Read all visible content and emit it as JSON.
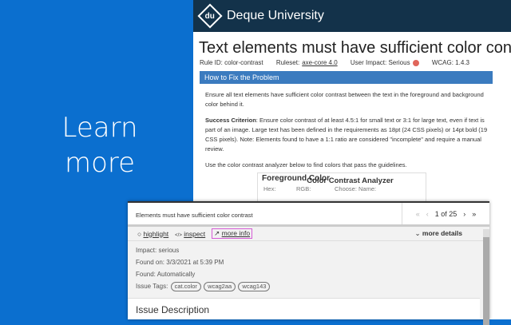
{
  "promo": {
    "text": "Learn more"
  },
  "site": {
    "logo": "du",
    "name": "Deque University"
  },
  "rule": {
    "title": "Text elements must have sufficient color contrast against",
    "rule_id": "Rule ID: color-contrast",
    "ruleset_label": "Ruleset:",
    "ruleset": "axe-core 4.0",
    "impact": "User Impact: Serious",
    "impact_color": "#e0665b",
    "wcag": "WCAG: 1.4.3"
  },
  "fix": {
    "heading": "How to Fix the Problem",
    "p1": "Ensure all text elements have sufficient color contrast between the text in the foreground and background color behind it.",
    "sc_label": "Success Criterion",
    "sc_text": ": Ensure color contrast of at least 4.5:1 for small text or 3:1 for large text, even if text is part of an image. Large text has been defined in the requirements as 18pt (24 CSS pixels) or 14pt bold (19 CSS pixels). Note: Elements found to have a 1:1 ratio are considered \"incomplete\" and require a manual review.",
    "p3": "Use the color contrast analyzer below to find colors that pass the guidelines.",
    "analyzer": "Color Contrast Analyzer",
    "fg": "Foreground Color",
    "hex": "Hex:",
    "rgb": "RGB:",
    "choose": "Choose:",
    "name": "Name:"
  },
  "panel": {
    "title": "Elements must have sufficient color contrast",
    "pager": "1 of 25",
    "highlight": "highlight",
    "inspect": "inspect",
    "more_info": "more info",
    "more_details": "more details",
    "impact": "Impact: serious",
    "found_on": "Found on: 3/3/2021 at 5:39 PM",
    "found": "Found: Automatically",
    "tags_label": "Issue Tags:",
    "tags": [
      "cat.color",
      "wcag2aa",
      "wcag143"
    ],
    "desc_heading": "Issue Description"
  }
}
